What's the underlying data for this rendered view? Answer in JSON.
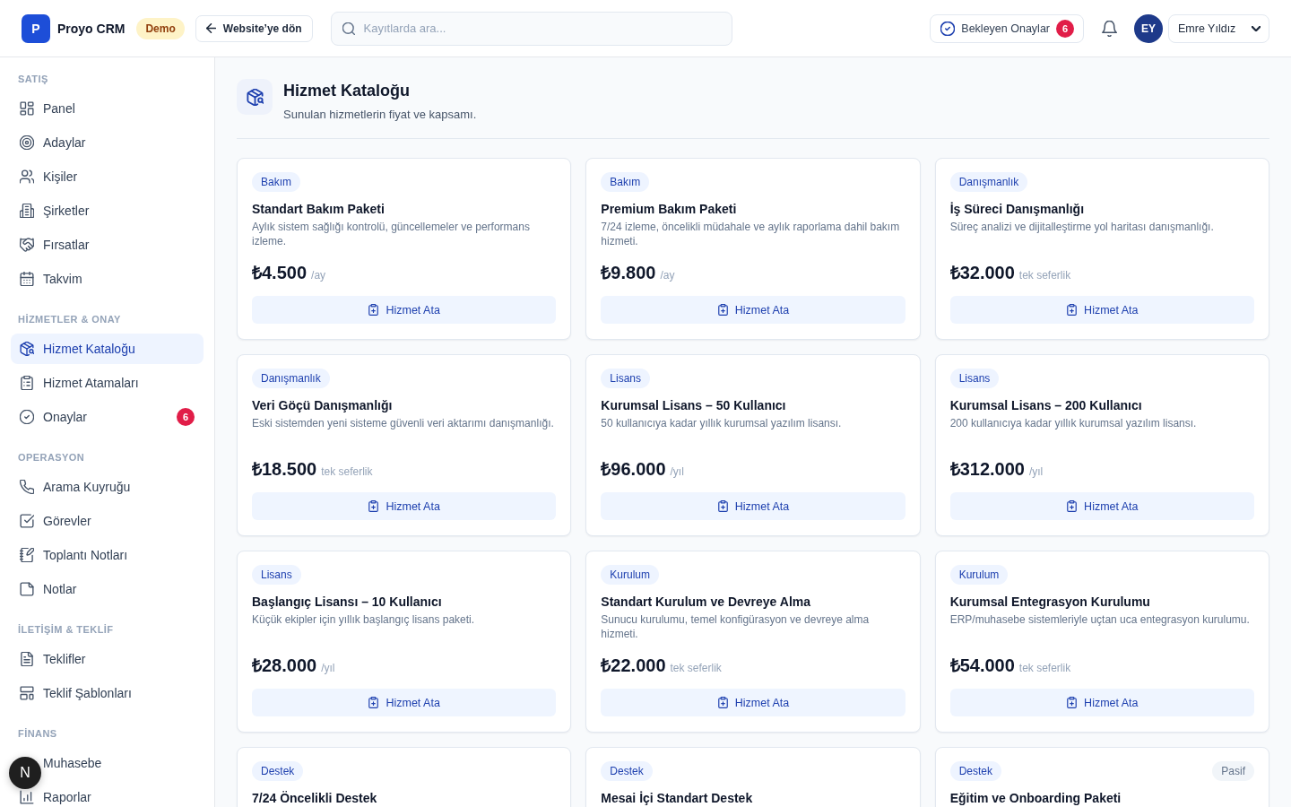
{
  "top_bar": {
    "logo": {
      "letter": "P",
      "name": "Proyo CRM"
    },
    "environment_badge": "Demo",
    "back_button": "Website’ye dön",
    "search": {
      "placeholder": "Kayıtlarda ara..."
    },
    "approvals_button": {
      "label": "Bekleyen Onaylar",
      "count": "6"
    },
    "user": {
      "initials": "EY",
      "name": "Emre Yıldız"
    }
  },
  "sidebar": {
    "sections": [
      {
        "title": "SATIŞ",
        "items": [
          {
            "label": "Panel",
            "selected": false
          },
          {
            "label": "Adaylar",
            "selected": false
          },
          {
            "label": "Kişiler",
            "selected": false
          },
          {
            "label": "Şirketler",
            "selected": false
          },
          {
            "label": "Fırsatlar",
            "selected": false
          },
          {
            "label": "Takvim",
            "selected": false
          }
        ]
      },
      {
        "title": "HİZMETLER & ONAY",
        "items": [
          {
            "label": "Hizmet Kataloğu",
            "selected": true
          },
          {
            "label": "Hizmet Atamaları",
            "selected": false
          },
          {
            "label": "Onaylar",
            "selected": false,
            "badge": "6"
          }
        ]
      },
      {
        "title": "OPERASYON",
        "items": [
          {
            "label": "Arama Kuyruğu",
            "selected": false
          },
          {
            "label": "Görevler",
            "selected": false
          },
          {
            "label": "Toplantı Notları",
            "selected": false
          },
          {
            "label": "Notlar",
            "selected": false
          }
        ]
      },
      {
        "title": "İLETİŞİM & TEKLİF",
        "items": [
          {
            "label": "Teklifler",
            "selected": false
          },
          {
            "label": "Teklif Şablonları",
            "selected": false
          }
        ]
      },
      {
        "title": "FİNANS",
        "items": [
          {
            "label": "Muhasebe",
            "selected": false
          },
          {
            "label": "Raporlar",
            "selected": false
          }
        ]
      }
    ]
  },
  "page_header": {
    "title": "Hizmet Kataloğu",
    "subtitle": "Sunulan hizmetlerin fiyat ve kapsamı."
  },
  "services": [
    {
      "category": "Bakım",
      "title": "Standart Bakım Paketi",
      "description": "Aylık sistem sağlığı kontrolü, güncellemeler ve performans izleme.",
      "price": "₺4.500",
      "period": "/ay",
      "action": "Hizmet Ata"
    },
    {
      "category": "Bakım",
      "title": "Premium Bakım Paketi",
      "description": "7/24 izleme, öncelikli müdahale ve aylık raporlama dahil bakım hizmeti.",
      "price": "₺9.800",
      "period": "/ay",
      "action": "Hizmet Ata"
    },
    {
      "category": "Danışmanlık",
      "title": "İş Süreci Danışmanlığı",
      "description": "Süreç analizi ve dijitalleştirme yol haritası danışmanlığı.",
      "price": "₺32.000",
      "period": "tek seferlik",
      "action": "Hizmet Ata"
    },
    {
      "category": "Danışmanlık",
      "title": "Veri Göçü Danışmanlığı",
      "description": "Eski sistemden yeni sisteme güvenli veri aktarımı danışmanlığı.",
      "price": "₺18.500",
      "period": "tek seferlik",
      "action": "Hizmet Ata"
    },
    {
      "category": "Lisans",
      "title": "Kurumsal Lisans – 50 Kullanıcı",
      "description": "50 kullanıcıya kadar yıllık kurumsal yazılım lisansı.",
      "price": "₺96.000",
      "period": "/yıl",
      "action": "Hizmet Ata"
    },
    {
      "category": "Lisans",
      "title": "Kurumsal Lisans – 200 Kullanıcı",
      "description": "200 kullanıcıya kadar yıllık kurumsal yazılım lisansı.",
      "price": "₺312.000",
      "period": "/yıl",
      "action": "Hizmet Ata"
    },
    {
      "category": "Lisans",
      "title": "Başlangıç Lisansı – 10 Kullanıcı",
      "description": "Küçük ekipler için yıllık başlangıç lisans paketi.",
      "price": "₺28.000",
      "period": "/yıl",
      "action": "Hizmet Ata"
    },
    {
      "category": "Kurulum",
      "title": "Standart Kurulum ve Devreye Alma",
      "description": "Sunucu kurulumu, temel konfigürasyon ve devreye alma hizmeti.",
      "price": "₺22.000",
      "period": "tek seferlik",
      "action": "Hizmet Ata"
    },
    {
      "category": "Kurulum",
      "title": "Kurumsal Entegrasyon Kurulumu",
      "description": "ERP/muhasebe sistemleriyle uçtan uca entegrasyon kurulumu.",
      "price": "₺54.000",
      "period": "tek seferlik",
      "action": "Hizmet Ata"
    },
    {
      "category": "Destek",
      "title": "7/24 Öncelikli Destek"
    },
    {
      "category": "Destek",
      "title": "Mesai İçi Standart Destek"
    },
    {
      "category": "Destek",
      "title": "Eğitim ve Onboarding Paketi",
      "status": "Pasif"
    }
  ],
  "dev_indicator": "N"
}
